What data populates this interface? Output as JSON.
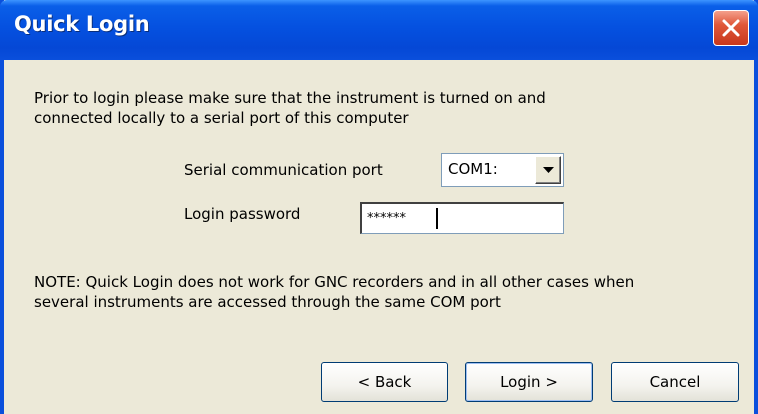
{
  "window": {
    "title": "Quick Login"
  },
  "intro": {
    "line1": "Prior to login please make sure that the instrument is turned on and",
    "line2": "connected locally to a serial port of this computer"
  },
  "port": {
    "label": "Serial communication port",
    "selected": "COM1:"
  },
  "password": {
    "label": "Login password",
    "value": "******"
  },
  "note": {
    "line1": "NOTE: Quick Login does not work for GNC recorders and in all other cases when",
    "line2": "several instruments are accessed through the same COM port"
  },
  "buttons": {
    "back": "< Back",
    "login": "Login >",
    "cancel": "Cancel"
  },
  "icons": {
    "close": "close-icon",
    "dropdown": "chevron-down-icon"
  },
  "colors": {
    "titlebar": "#0551e0",
    "close_button": "#e0583a",
    "dialog_background": "#ece9d8"
  }
}
